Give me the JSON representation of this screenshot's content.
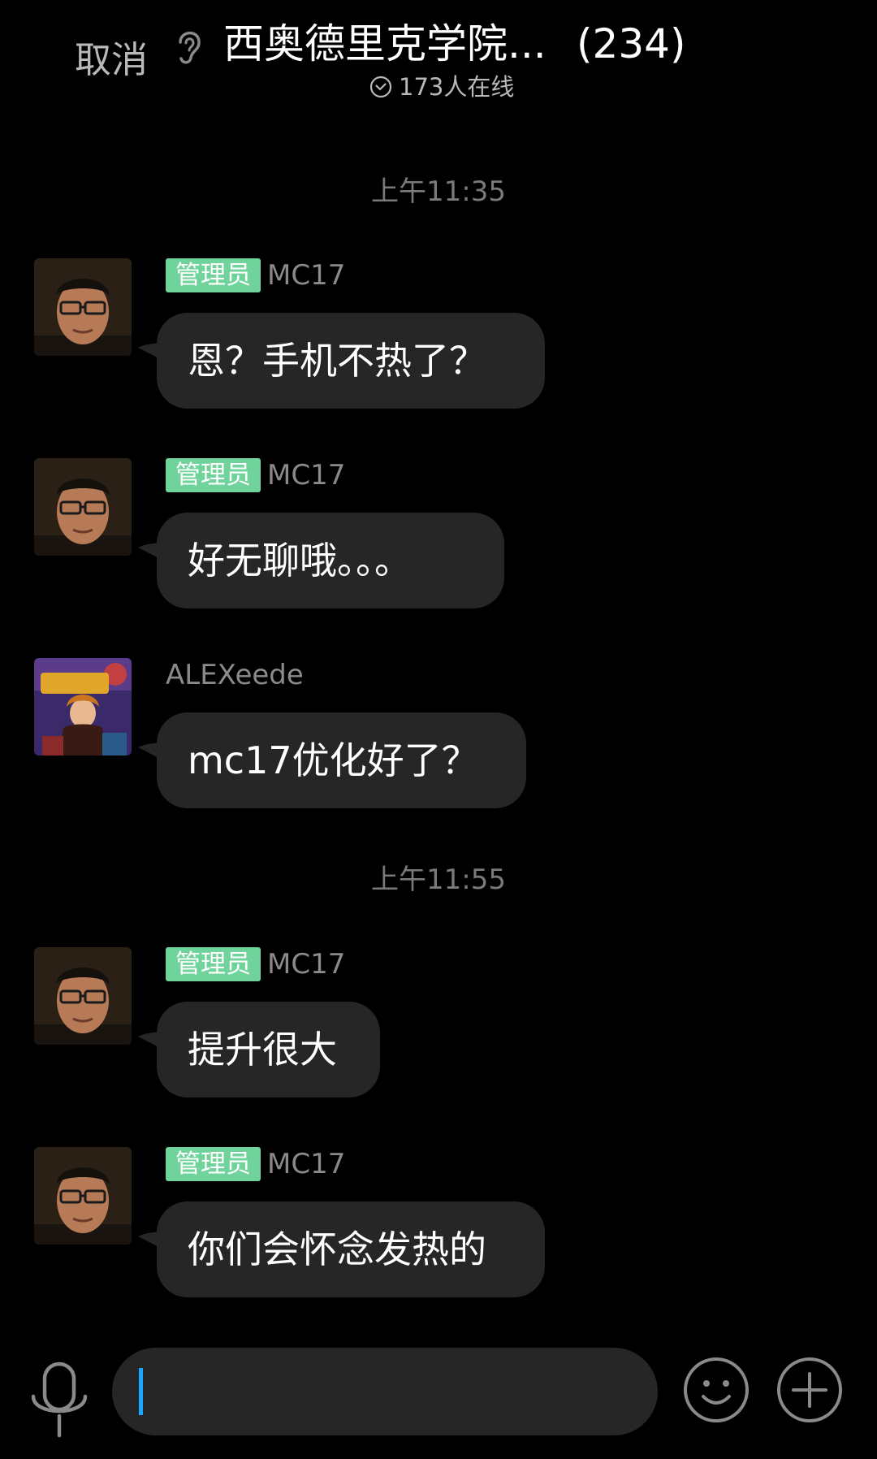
{
  "header": {
    "cancel_label": "取消",
    "group_name": "西奥德里克学院...",
    "member_count": "(234)",
    "online_text": "173人在线"
  },
  "chat": {
    "timestamps": [
      "上午11:35",
      "上午11:55"
    ],
    "messages": [
      {
        "badge": "管理员",
        "sender": "MC17",
        "text": "恩？手机不热了？",
        "avatar": "portrait-glasses"
      },
      {
        "badge": "管理员",
        "sender": "MC17",
        "text": "好无聊哦。。。",
        "avatar": "portrait-glasses"
      },
      {
        "badge": "",
        "sender": "ALEXeede",
        "text": "mc17优化好了？",
        "avatar": "anime-art"
      },
      {
        "badge": "管理员",
        "sender": "MC17",
        "text": "提升很大",
        "avatar": "portrait-glasses"
      },
      {
        "badge": "管理员",
        "sender": "MC17",
        "text": "你们会怀念发热的",
        "avatar": "portrait-glasses"
      }
    ]
  },
  "input_bar": {
    "value": "",
    "placeholder": ""
  },
  "colors": {
    "background": "#000000",
    "bubble": "#262626",
    "admin_badge": "#6fd39b",
    "caret": "#19a8ff"
  },
  "icons": [
    "ear-icon",
    "check-circle-icon",
    "microphone-icon",
    "emoji-icon",
    "plus-circle-icon"
  ]
}
